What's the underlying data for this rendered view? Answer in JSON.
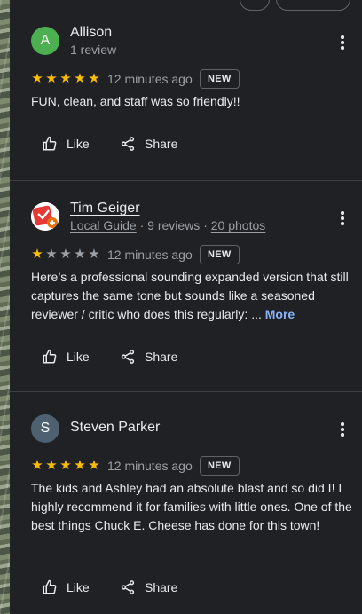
{
  "reviews": [
    {
      "initial": "A",
      "name": "Allison",
      "meta": "1 review",
      "rating": 5,
      "time": "12 minutes ago",
      "badge": "NEW",
      "text": "FUN, clean, and staff was so friendly!!",
      "like_label": "Like",
      "share_label": "Share",
      "avatar_color": "#4caf50"
    },
    {
      "name": "Tim Geiger",
      "meta_guide": "Local Guide",
      "meta_sep1": " · ",
      "meta_reviews": "9 reviews",
      "meta_sep2": " · ",
      "meta_photos": "20 photos",
      "rating": 1,
      "time": "12 minutes ago",
      "badge": "NEW",
      "text": "Here’s a professional sounding expanded version that still captures the same tone but sounds like a seasoned reviewer / critic who does this regularly: ...",
      "more_label": "More",
      "like_label": "Like",
      "share_label": "Share"
    },
    {
      "initial": "S",
      "name": "Steven Parker",
      "rating": 5,
      "time": "12 minutes ago",
      "badge": "NEW",
      "text": "The kids and Ashley had an absolute blast and so did I! I highly recommend it for families with little ones. One of the best things Chuck E. Cheese has done for this town!",
      "like_label": "Like",
      "share_label": "Share",
      "avatar_color": "#4d6170"
    }
  ],
  "colors": {
    "star": "#fbbc04",
    "link": "#8ab4f8",
    "background": "#202124"
  },
  "icons": {
    "more": "more-vert-icon",
    "like": "thumb-up-icon",
    "share": "share-icon"
  }
}
